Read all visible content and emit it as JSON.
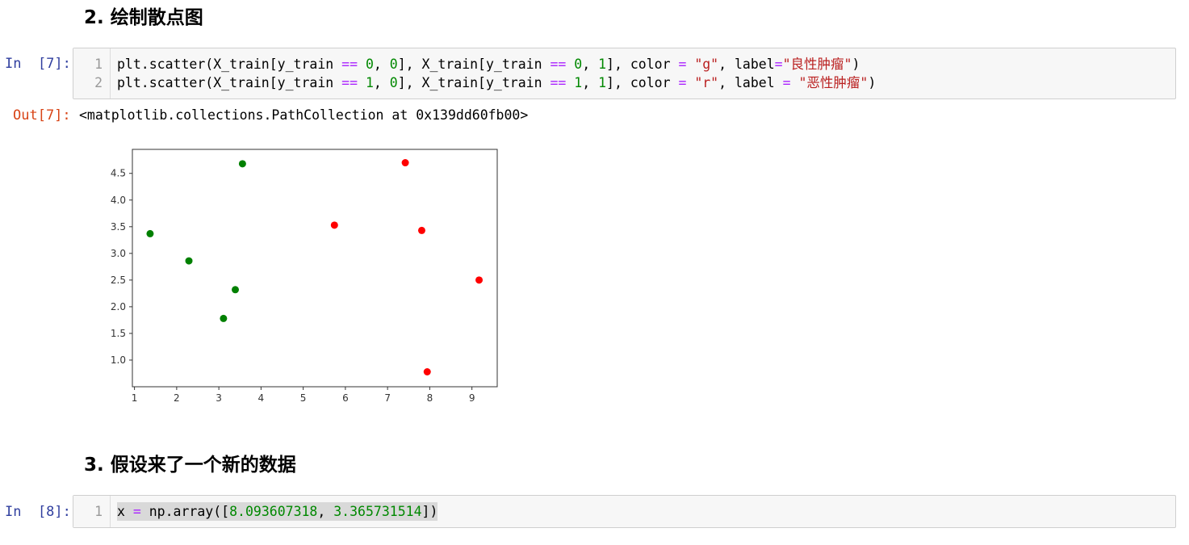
{
  "headings": {
    "h2": "2. 绘制散点图",
    "h3": "3. 假设来了一个新的数据"
  },
  "cell7": {
    "prompt_in": "In  [7]:",
    "prompt_out": "Out[7]:",
    "lines": [
      {
        "num": "1",
        "tokens": [
          {
            "t": "plt.scatter(X_train[y_train ",
            "c": ""
          },
          {
            "t": "==",
            "c": "kw-op"
          },
          {
            "t": " ",
            "c": ""
          },
          {
            "t": "0",
            "c": "num"
          },
          {
            "t": ", ",
            "c": ""
          },
          {
            "t": "0",
            "c": "num"
          },
          {
            "t": "], X_train[y_train ",
            "c": ""
          },
          {
            "t": "==",
            "c": "kw-op"
          },
          {
            "t": " ",
            "c": ""
          },
          {
            "t": "0",
            "c": "num"
          },
          {
            "t": ", ",
            "c": ""
          },
          {
            "t": "1",
            "c": "num"
          },
          {
            "t": "], color ",
            "c": ""
          },
          {
            "t": "=",
            "c": "kw-op"
          },
          {
            "t": " ",
            "c": ""
          },
          {
            "t": "\"g\"",
            "c": "str"
          },
          {
            "t": ", label",
            "c": ""
          },
          {
            "t": "=",
            "c": "kw-op"
          },
          {
            "t": "\"良性肿瘤\"",
            "c": "str"
          },
          {
            "t": ")",
            "c": ""
          }
        ]
      },
      {
        "num": "2",
        "tokens": [
          {
            "t": "plt.scatter(X_train[y_train ",
            "c": ""
          },
          {
            "t": "==",
            "c": "kw-op"
          },
          {
            "t": " ",
            "c": ""
          },
          {
            "t": "1",
            "c": "num"
          },
          {
            "t": ", ",
            "c": ""
          },
          {
            "t": "0",
            "c": "num"
          },
          {
            "t": "], X_train[y_train ",
            "c": ""
          },
          {
            "t": "==",
            "c": "kw-op"
          },
          {
            "t": " ",
            "c": ""
          },
          {
            "t": "1",
            "c": "num"
          },
          {
            "t": ", ",
            "c": ""
          },
          {
            "t": "1",
            "c": "num"
          },
          {
            "t": "], color ",
            "c": ""
          },
          {
            "t": "=",
            "c": "kw-op"
          },
          {
            "t": " ",
            "c": ""
          },
          {
            "t": "\"r\"",
            "c": "str"
          },
          {
            "t": ", label ",
            "c": ""
          },
          {
            "t": "=",
            "c": "kw-op"
          },
          {
            "t": " ",
            "c": ""
          },
          {
            "t": "\"恶性肿瘤\"",
            "c": "str"
          },
          {
            "t": ")",
            "c": ""
          }
        ]
      }
    ],
    "output_text": "<matplotlib.collections.PathCollection at 0x139dd60fb00>"
  },
  "cell8": {
    "prompt_in": "In  [8]:",
    "lines": [
      {
        "num": "1",
        "tokens": [
          {
            "t": "x ",
            "c": ""
          },
          {
            "t": "=",
            "c": "kw-op"
          },
          {
            "t": " np.array([",
            "c": ""
          },
          {
            "t": "8.093607318",
            "c": "num"
          },
          {
            "t": ", ",
            "c": ""
          },
          {
            "t": "3.365731514",
            "c": "num"
          },
          {
            "t": "])",
            "c": ""
          }
        ]
      }
    ]
  },
  "chart_data": {
    "type": "scatter",
    "title": "",
    "xlabel": "",
    "ylabel": "",
    "xlim": [
      0.95,
      9.6
    ],
    "ylim": [
      0.5,
      4.95
    ],
    "xticks": [
      1,
      2,
      3,
      4,
      5,
      6,
      7,
      8,
      9
    ],
    "yticks": [
      1.0,
      1.5,
      2.0,
      2.5,
      3.0,
      3.5,
      4.0,
      4.5
    ],
    "grid": false,
    "series": [
      {
        "color": "#008000",
        "points": [
          [
            1.37,
            3.37
          ],
          [
            2.29,
            2.86
          ],
          [
            3.11,
            1.78
          ],
          [
            3.39,
            2.32
          ],
          [
            3.56,
            4.68
          ]
        ]
      },
      {
        "color": "#ff0000",
        "points": [
          [
            5.74,
            3.53
          ],
          [
            7.42,
            4.7
          ],
          [
            7.81,
            3.43
          ],
          [
            7.94,
            0.78
          ],
          [
            9.17,
            2.5
          ]
        ]
      }
    ]
  }
}
